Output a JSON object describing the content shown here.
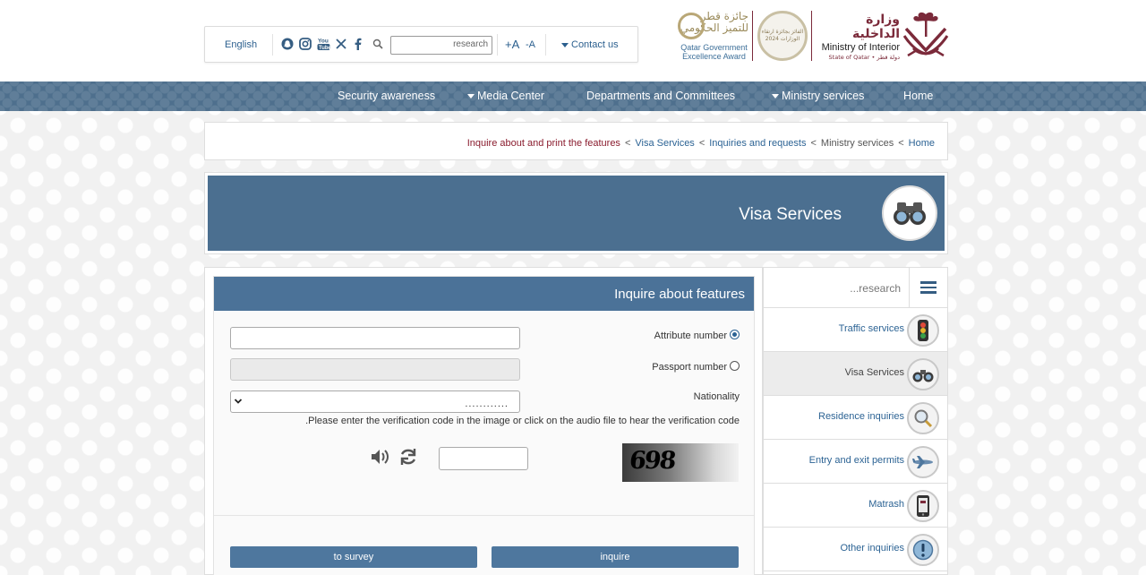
{
  "header": {
    "language_link": "English",
    "search_placeholder": "research",
    "font_increase": "+A",
    "font_decrease": "-A",
    "contact_label": "Contact us",
    "award_arabic": "جائزة قطر للتميز الحكومي",
    "award_english_1": "Qatar Government",
    "award_english_2": "Excellence Award",
    "medal_text": "الفائز بجائزة ارتقاء الوزارات 2024",
    "ministry_arabic": "وزارة الداخلية",
    "ministry_english": "Ministry of Interior",
    "ministry_sub": "State of Qatar • دولة قطر",
    "social_icons": [
      "snapchat-icon",
      "instagram-icon",
      "youtube-icon",
      "x-icon",
      "facebook-icon",
      "search-icon"
    ]
  },
  "nav": {
    "items": [
      {
        "label": "Security awareness",
        "dropdown": false
      },
      {
        "label": "Media Center",
        "dropdown": true
      },
      {
        "label": "Departments and Committees",
        "dropdown": false
      },
      {
        "label": "Ministry services",
        "dropdown": true
      },
      {
        "label": "Home",
        "dropdown": false
      }
    ]
  },
  "breadcrumb": {
    "current": "Inquire about and print the features",
    "visa": "Visa Services",
    "inquiries": "Inquiries and requests",
    "ministry": "Ministry services",
    "home": "Home",
    "separator": "<"
  },
  "banner": {
    "title": "Visa Services"
  },
  "sidebar": {
    "search_placeholder": "...research",
    "items": [
      {
        "label": "Traffic services",
        "icon": "traffic-light-icon",
        "active": false
      },
      {
        "label": "Visa Services",
        "icon": "binoculars-icon",
        "active": true
      },
      {
        "label": "Residence inquiries",
        "icon": "magnifier-icon",
        "active": false
      },
      {
        "label": "Entry and exit permits",
        "icon": "airplane-icon",
        "active": false
      },
      {
        "label": "Matrash",
        "icon": "phone-app-icon",
        "active": false
      },
      {
        "label": "Other inquiries",
        "icon": "exclamation-icon",
        "active": false
      }
    ]
  },
  "form": {
    "title": "Inquire about features",
    "attribute_label": "Attribute number",
    "passport_label": "Passport number",
    "nationality_label": "Nationality",
    "nationality_value": "............",
    "selected_option": "Attribute number",
    "note": ".Please enter the verification code in the image or click on the audio file to hear the verification code",
    "captcha_text": "698",
    "survey_button": "to survey",
    "inquire_button": "inquire"
  },
  "colors": {
    "nav_bg": "#4e6f8d",
    "banner_bg": "#4b6f90",
    "panel_head": "#4b7298",
    "link": "#2c6394",
    "brand_maroon": "#7b2a3a"
  }
}
